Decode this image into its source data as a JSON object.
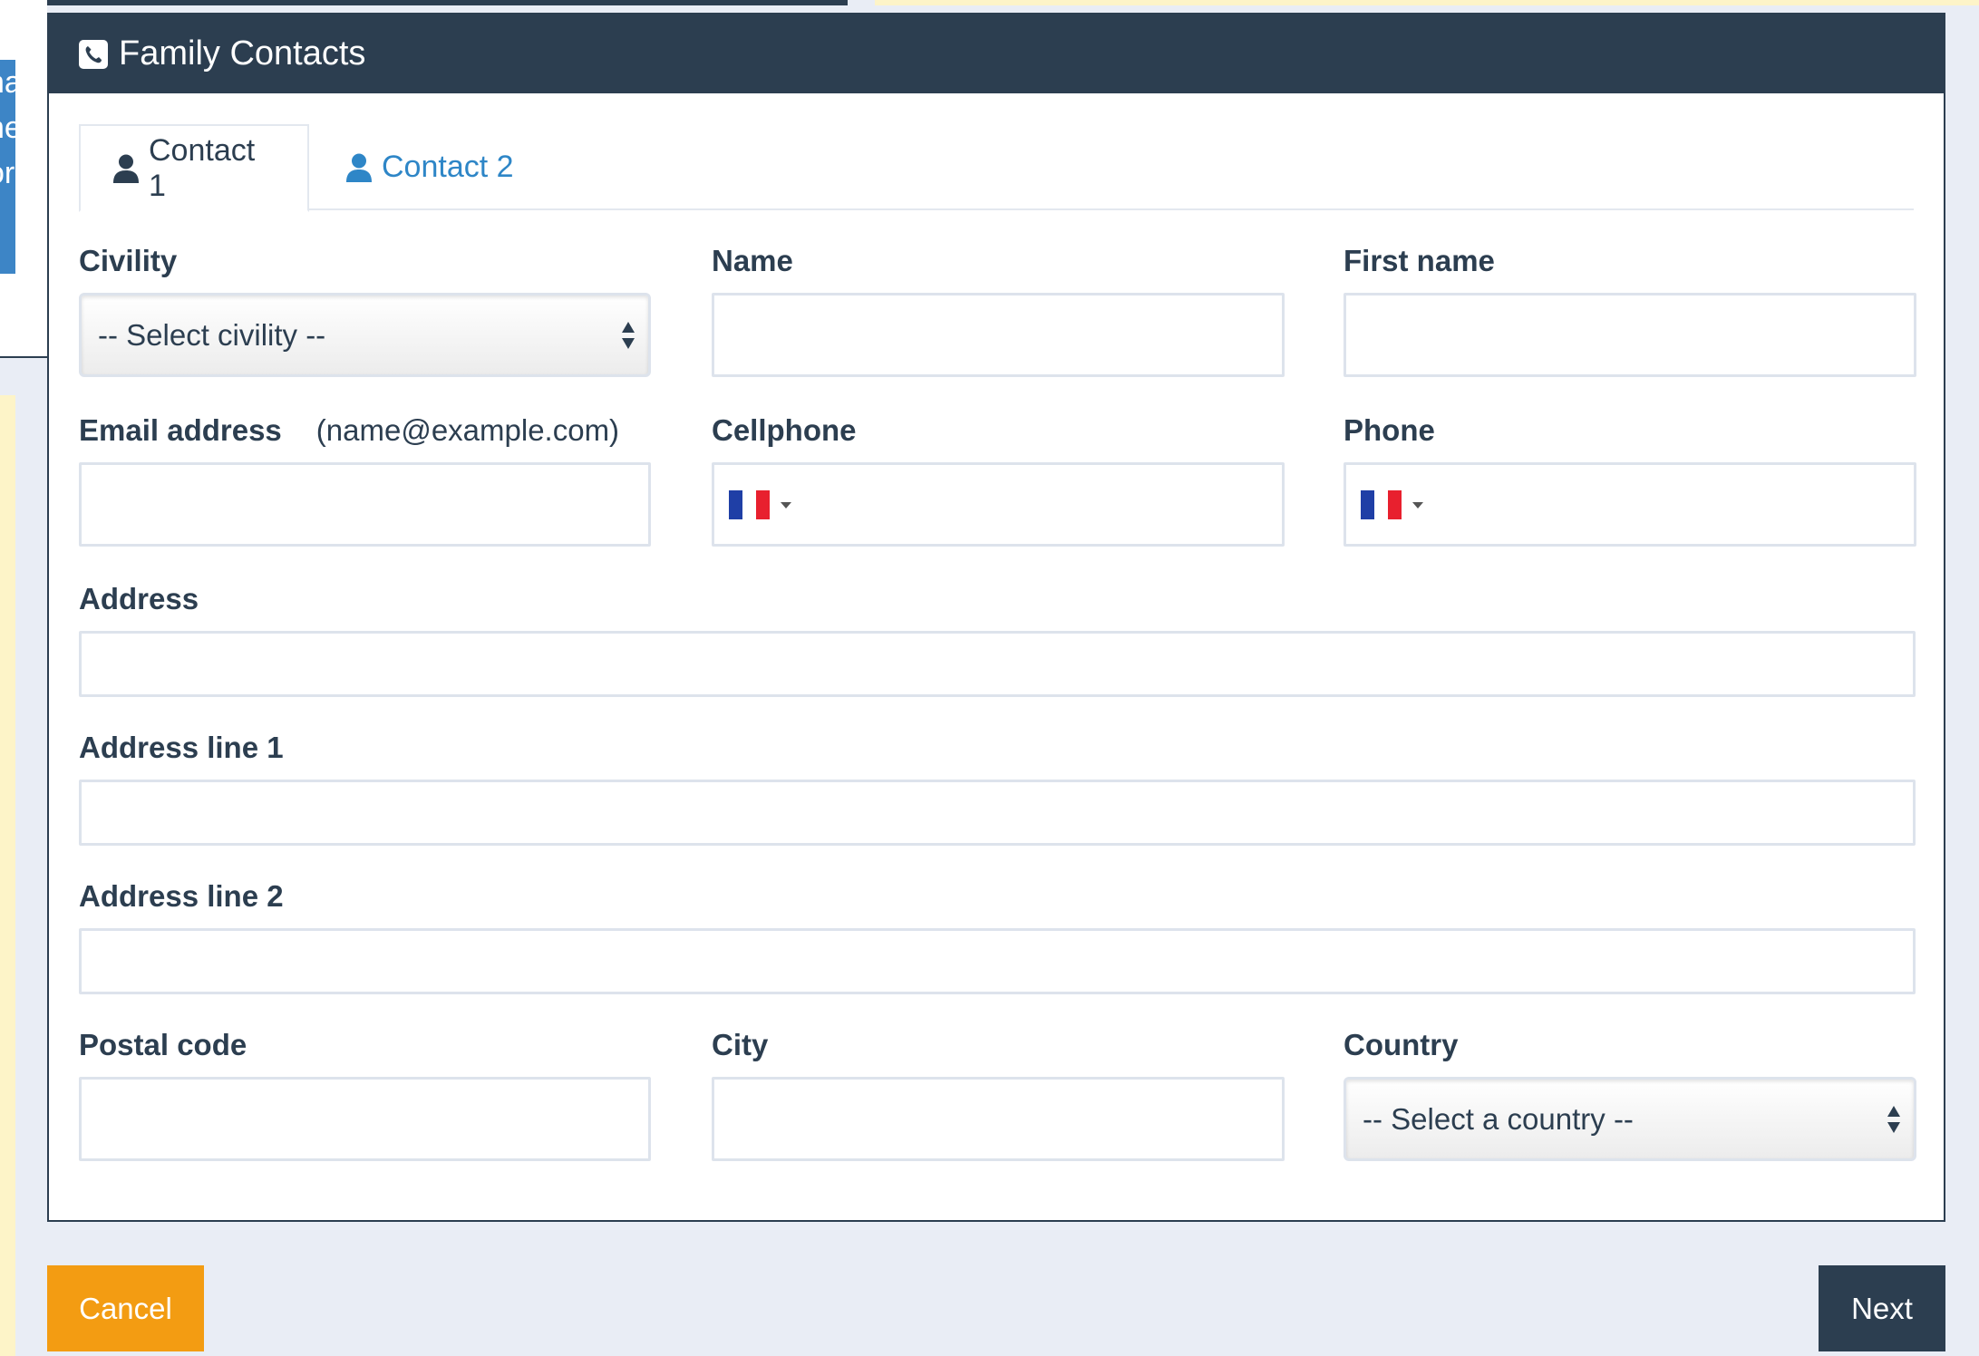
{
  "background": {
    "side_text": [
      "na",
      "he",
      "or"
    ]
  },
  "panel": {
    "title": "Family Contacts",
    "icon": "phone-square-icon"
  },
  "tabs": [
    {
      "label": "Contact 1",
      "icon": "user-icon",
      "active": true
    },
    {
      "label": "Contact 2",
      "icon": "user-icon",
      "active": false
    }
  ],
  "form": {
    "civility": {
      "label": "Civility",
      "value": "-- Select civility --"
    },
    "name": {
      "label": "Name",
      "value": ""
    },
    "first_name": {
      "label": "First name",
      "value": ""
    },
    "email": {
      "label": "Email address",
      "hint": "(name@example.com)",
      "value": ""
    },
    "cellphone": {
      "label": "Cellphone",
      "country_flag": "FR",
      "value": ""
    },
    "phone": {
      "label": "Phone",
      "country_flag": "FR",
      "value": ""
    },
    "address": {
      "label": "Address",
      "value": ""
    },
    "address_line_1": {
      "label": "Address line 1",
      "value": ""
    },
    "address_line_2": {
      "label": "Address line 2",
      "value": ""
    },
    "postal_code": {
      "label": "Postal code",
      "value": ""
    },
    "city": {
      "label": "City",
      "value": ""
    },
    "country": {
      "label": "Country",
      "value": "-- Select a country --"
    }
  },
  "buttons": {
    "cancel": "Cancel",
    "next": "Next"
  },
  "colors": {
    "header_bg": "#2c3e50",
    "tab_link": "#2e86c7",
    "cancel_bg": "#f39c12",
    "next_bg": "#2c3e50",
    "page_bg": "#e9edf5"
  }
}
